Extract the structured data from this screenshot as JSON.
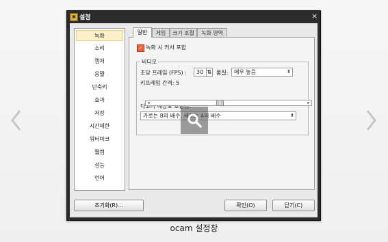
{
  "window": {
    "title": "설정",
    "close_glyph": "×"
  },
  "sidebar": {
    "items": [
      {
        "label": "녹화",
        "selected": true
      },
      {
        "label": "소리",
        "selected": false
      },
      {
        "label": "캡처",
        "selected": false
      },
      {
        "label": "응짤",
        "selected": false
      },
      {
        "label": "단축키",
        "selected": false
      },
      {
        "label": "효과",
        "selected": false
      },
      {
        "label": "저장",
        "selected": false
      },
      {
        "label": "시간제한",
        "selected": false
      },
      {
        "label": "워터마크",
        "selected": false
      },
      {
        "label": "웹캠",
        "selected": false
      },
      {
        "label": "성능",
        "selected": false
      },
      {
        "label": "언어",
        "selected": false
      }
    ]
  },
  "tabs": [
    {
      "label": "일반",
      "active": true
    },
    {
      "label": "게임",
      "active": false
    },
    {
      "label": "크기 조절",
      "active": false
    },
    {
      "label": "녹화 영역",
      "active": false
    }
  ],
  "general": {
    "include_cursor_label": "녹화 시 커서 포함",
    "include_cursor_checked": true,
    "video_group_title": "비디오",
    "fps_label": "초당 프레임 (FPS) :",
    "fps_value": "30",
    "quality_label": "품질:",
    "quality_value": "매우 높음",
    "keyframe_label": "키프레임 간격: 5",
    "keyframe_level_fraction": 0.44,
    "decoder_label": "디코더 해상도 호환성:",
    "decoder_value": "가로는 8의 배수, 세로는 4의 배수"
  },
  "buttons": {
    "reset": "초기화(R)...",
    "ok": "확인(O)",
    "close": "닫기(C)"
  },
  "caption": "ocam 설정창",
  "icons": {
    "prev": "chevron-left-icon",
    "next": "chevron-right-icon",
    "zoom": "magnifier-icon"
  }
}
